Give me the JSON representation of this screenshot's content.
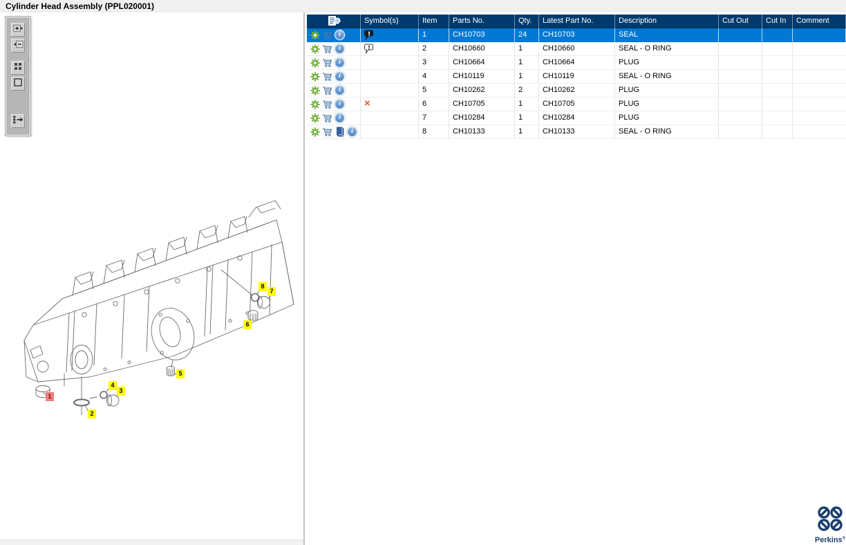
{
  "window": {
    "title": "Cylinder Head Assembly (PPL020001)"
  },
  "left_panel": {
    "toolbar": [
      {
        "name": "zoom-in"
      },
      {
        "name": "zoom-out"
      },
      {
        "name": "tile-view"
      },
      {
        "name": "fit-view"
      },
      {
        "name": "toggle-panel"
      }
    ]
  },
  "diagram": {
    "callouts": [
      {
        "number": "1",
        "selected": true
      },
      {
        "number": "2",
        "selected": false
      },
      {
        "number": "3",
        "selected": false
      },
      {
        "number": "4",
        "selected": false
      },
      {
        "number": "5",
        "selected": false
      },
      {
        "number": "6",
        "selected": false
      },
      {
        "number": "7",
        "selected": false
      },
      {
        "number": "8",
        "selected": false
      }
    ]
  },
  "table": {
    "columns": [
      "",
      "Symbol(s)",
      "Item",
      "Parts No.",
      "Qty.",
      "Latest Part No.",
      "Description",
      "Cut Out",
      "Cut In",
      "Comment"
    ],
    "header_icon": "document-search-icon",
    "rows": [
      {
        "selected": true,
        "icons": [
          "gear",
          "cart",
          "info"
        ],
        "symbol": "note-filled",
        "item": "1",
        "parts_no": "CH10703",
        "qty": "24",
        "latest_part_no": "CH10703",
        "description": "SEAL",
        "cut_out": "",
        "cut_in": "",
        "comment": ""
      },
      {
        "selected": false,
        "icons": [
          "gear",
          "cart",
          "info"
        ],
        "symbol": "note-outline",
        "item": "2",
        "parts_no": "CH10660",
        "qty": "1",
        "latest_part_no": "CH10660",
        "description": "SEAL - O RING",
        "cut_out": "",
        "cut_in": "",
        "comment": ""
      },
      {
        "selected": false,
        "icons": [
          "gear",
          "cart",
          "info"
        ],
        "symbol": "",
        "item": "3",
        "parts_no": "CH10664",
        "qty": "1",
        "latest_part_no": "CH10664",
        "description": "PLUG",
        "cut_out": "",
        "cut_in": "",
        "comment": ""
      },
      {
        "selected": false,
        "icons": [
          "gear",
          "cart",
          "info"
        ],
        "symbol": "",
        "item": "4",
        "parts_no": "CH10119",
        "qty": "1",
        "latest_part_no": "CH10119",
        "description": "SEAL - O RING",
        "cut_out": "",
        "cut_in": "",
        "comment": ""
      },
      {
        "selected": false,
        "icons": [
          "gear",
          "cart",
          "info"
        ],
        "symbol": "",
        "item": "5",
        "parts_no": "CH10262",
        "qty": "2",
        "latest_part_no": "CH10262",
        "description": "PLUG",
        "cut_out": "",
        "cut_in": "",
        "comment": ""
      },
      {
        "selected": false,
        "icons": [
          "gear",
          "cart",
          "info"
        ],
        "symbol": "red-x",
        "item": "6",
        "parts_no": "CH10705",
        "qty": "1",
        "latest_part_no": "CH10705",
        "description": "PLUG",
        "cut_out": "",
        "cut_in": "",
        "comment": ""
      },
      {
        "selected": false,
        "icons": [
          "gear",
          "cart",
          "info"
        ],
        "symbol": "",
        "item": "7",
        "parts_no": "CH10284",
        "qty": "1",
        "latest_part_no": "CH10284",
        "description": "PLUG",
        "cut_out": "",
        "cut_in": "",
        "comment": ""
      },
      {
        "selected": false,
        "icons": [
          "gear",
          "cart",
          "book",
          "info"
        ],
        "symbol": "",
        "item": "8",
        "parts_no": "CH10133",
        "qty": "1",
        "latest_part_no": "CH10133",
        "description": "SEAL - O RING",
        "cut_out": "",
        "cut_in": "",
        "comment": ""
      }
    ]
  },
  "branding": {
    "name": "Perkins"
  },
  "colors": {
    "header_bg": "#003a6d",
    "selected_row_bg": "#0078d4",
    "accent_green": "#76b043",
    "accent_blue": "#4d79a8",
    "callout_yellow": "#ffff00",
    "callout_selected": "#f08080",
    "symbol_x": "#e8532e",
    "logo_blue": "#1b3e6f"
  }
}
